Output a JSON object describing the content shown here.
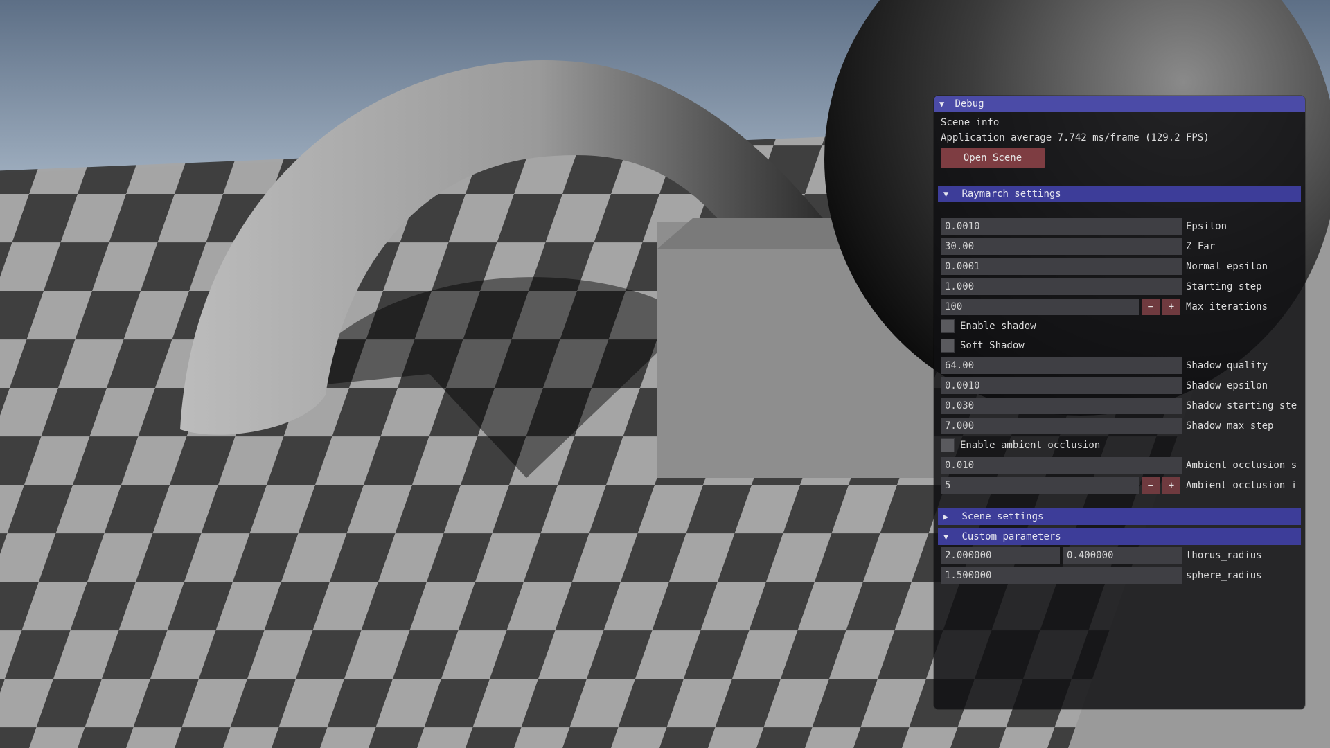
{
  "debug": {
    "title": "Debug",
    "scene_info": "Scene info",
    "app_average": "Application average 7.742 ms/frame (129.2 FPS)",
    "open_scene": "Open Scene"
  },
  "raymarch": {
    "header": "Raymarch settings",
    "epsilon": {
      "value": "0.0010",
      "label": "Epsilon"
    },
    "z_far": {
      "value": "30.00",
      "label": "Z Far"
    },
    "normal_epsilon": {
      "value": "0.0001",
      "label": "Normal epsilon"
    },
    "starting_step": {
      "value": "1.000",
      "label": "Starting step"
    },
    "max_iterations": {
      "value": "100",
      "label": "Max iterations"
    },
    "enable_shadow": "Enable shadow",
    "soft_shadow": "Soft Shadow",
    "shadow_quality": {
      "value": "64.00",
      "label": "Shadow quality"
    },
    "shadow_epsilon": {
      "value": "0.0010",
      "label": "Shadow epsilon"
    },
    "shadow_starting_step": {
      "value": "0.030",
      "label": "Shadow starting ste"
    },
    "shadow_max_step": {
      "value": "7.000",
      "label": "Shadow max step"
    },
    "enable_ao": "Enable ambient occlusion",
    "ao_s": {
      "value": "0.010",
      "label": "Ambient occlusion s"
    },
    "ao_i": {
      "value": "5",
      "label": "Ambient occlusion i"
    }
  },
  "steppers": {
    "minus": "−",
    "plus": "+"
  },
  "scene_settings": {
    "header": "Scene settings"
  },
  "custom": {
    "header": "Custom parameters",
    "thorus_radius": {
      "a": "2.000000",
      "b": "0.400000",
      "label": "thorus_radius"
    },
    "sphere_radius": {
      "value": "1.500000",
      "label": "sphere_radius"
    }
  },
  "icons": {
    "expanded": "▼",
    "collapsed": "▶"
  },
  "colors": {
    "title_bar": "#4b4ba7",
    "header": "#3d3d99",
    "button": "#7e3d42"
  }
}
